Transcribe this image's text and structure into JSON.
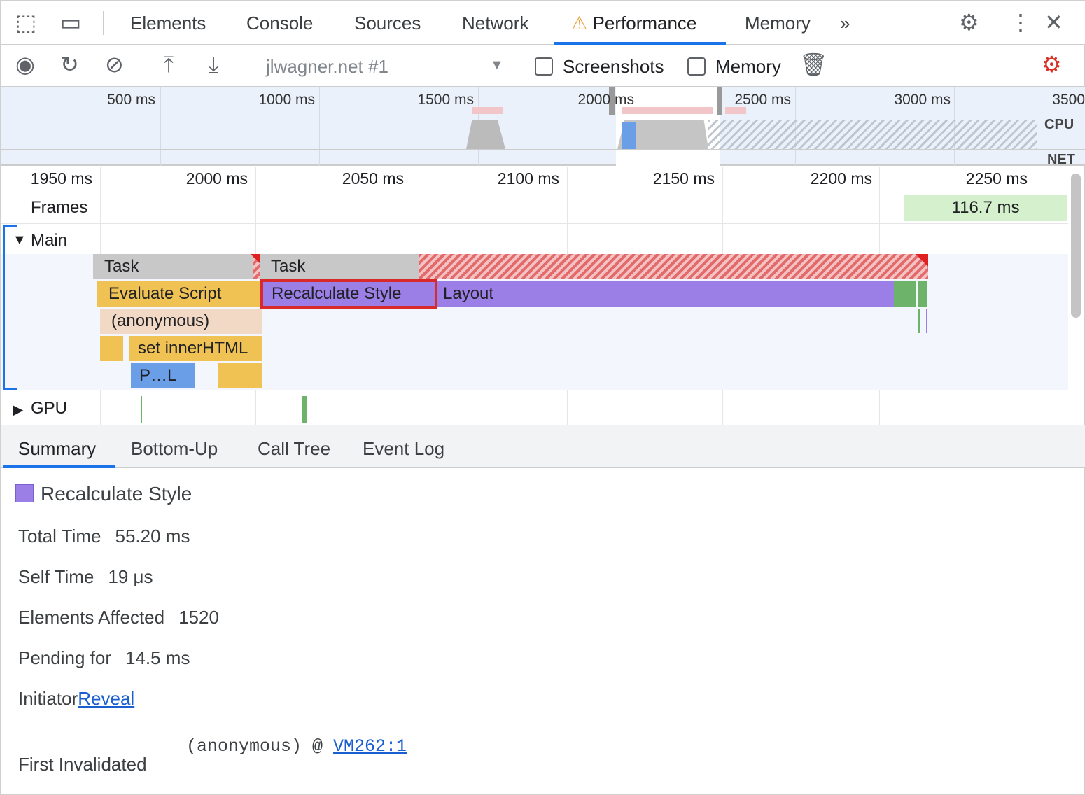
{
  "tabs": [
    "Elements",
    "Console",
    "Sources",
    "Network",
    "Performance",
    "Memory"
  ],
  "active_tab": "Performance",
  "toolbar": {
    "target": "jlwagner.net #1",
    "screenshots_label": "Screenshots",
    "memory_label": "Memory"
  },
  "overview": {
    "ticks": [
      "500 ms",
      "1000 ms",
      "1500 ms",
      "2000 ms",
      "2500 ms",
      "3000 ms",
      "3500"
    ],
    "cpu_label": "CPU",
    "net_label": "NET"
  },
  "ruler": [
    "1950 ms",
    "2000 ms",
    "2050 ms",
    "2100 ms",
    "2150 ms",
    "2200 ms",
    "2250 ms"
  ],
  "tracks": {
    "frames": "Frames",
    "frame_duration": "116.7 ms",
    "main": "Main",
    "gpu": "GPU"
  },
  "flame": {
    "task1": "Task",
    "task2": "Task",
    "evaluate": "Evaluate Script",
    "recalc": "Recalculate Style",
    "layout": "Layout",
    "anonymous": "(anonymous)",
    "innerhtml": "set innerHTML",
    "parse": "P…L"
  },
  "bottom_tabs": [
    "Summary",
    "Bottom-Up",
    "Call Tree",
    "Event Log"
  ],
  "summary": {
    "title": "Recalculate Style",
    "color": "#9b7fe6",
    "total_time_label": "Total Time",
    "total_time": "55.20 ms",
    "self_time_label": "Self Time",
    "self_time": "19 μs",
    "elements_label": "Elements Affected",
    "elements": "1520",
    "pending_label": "Pending for",
    "pending": "14.5 ms",
    "initiator_label": "Initiator",
    "initiator_link": "Reveal",
    "first_invalidated_label": "First Invalidated",
    "first_invalidated_fn": "(anonymous) @ ",
    "first_invalidated_link": "VM262:1"
  }
}
